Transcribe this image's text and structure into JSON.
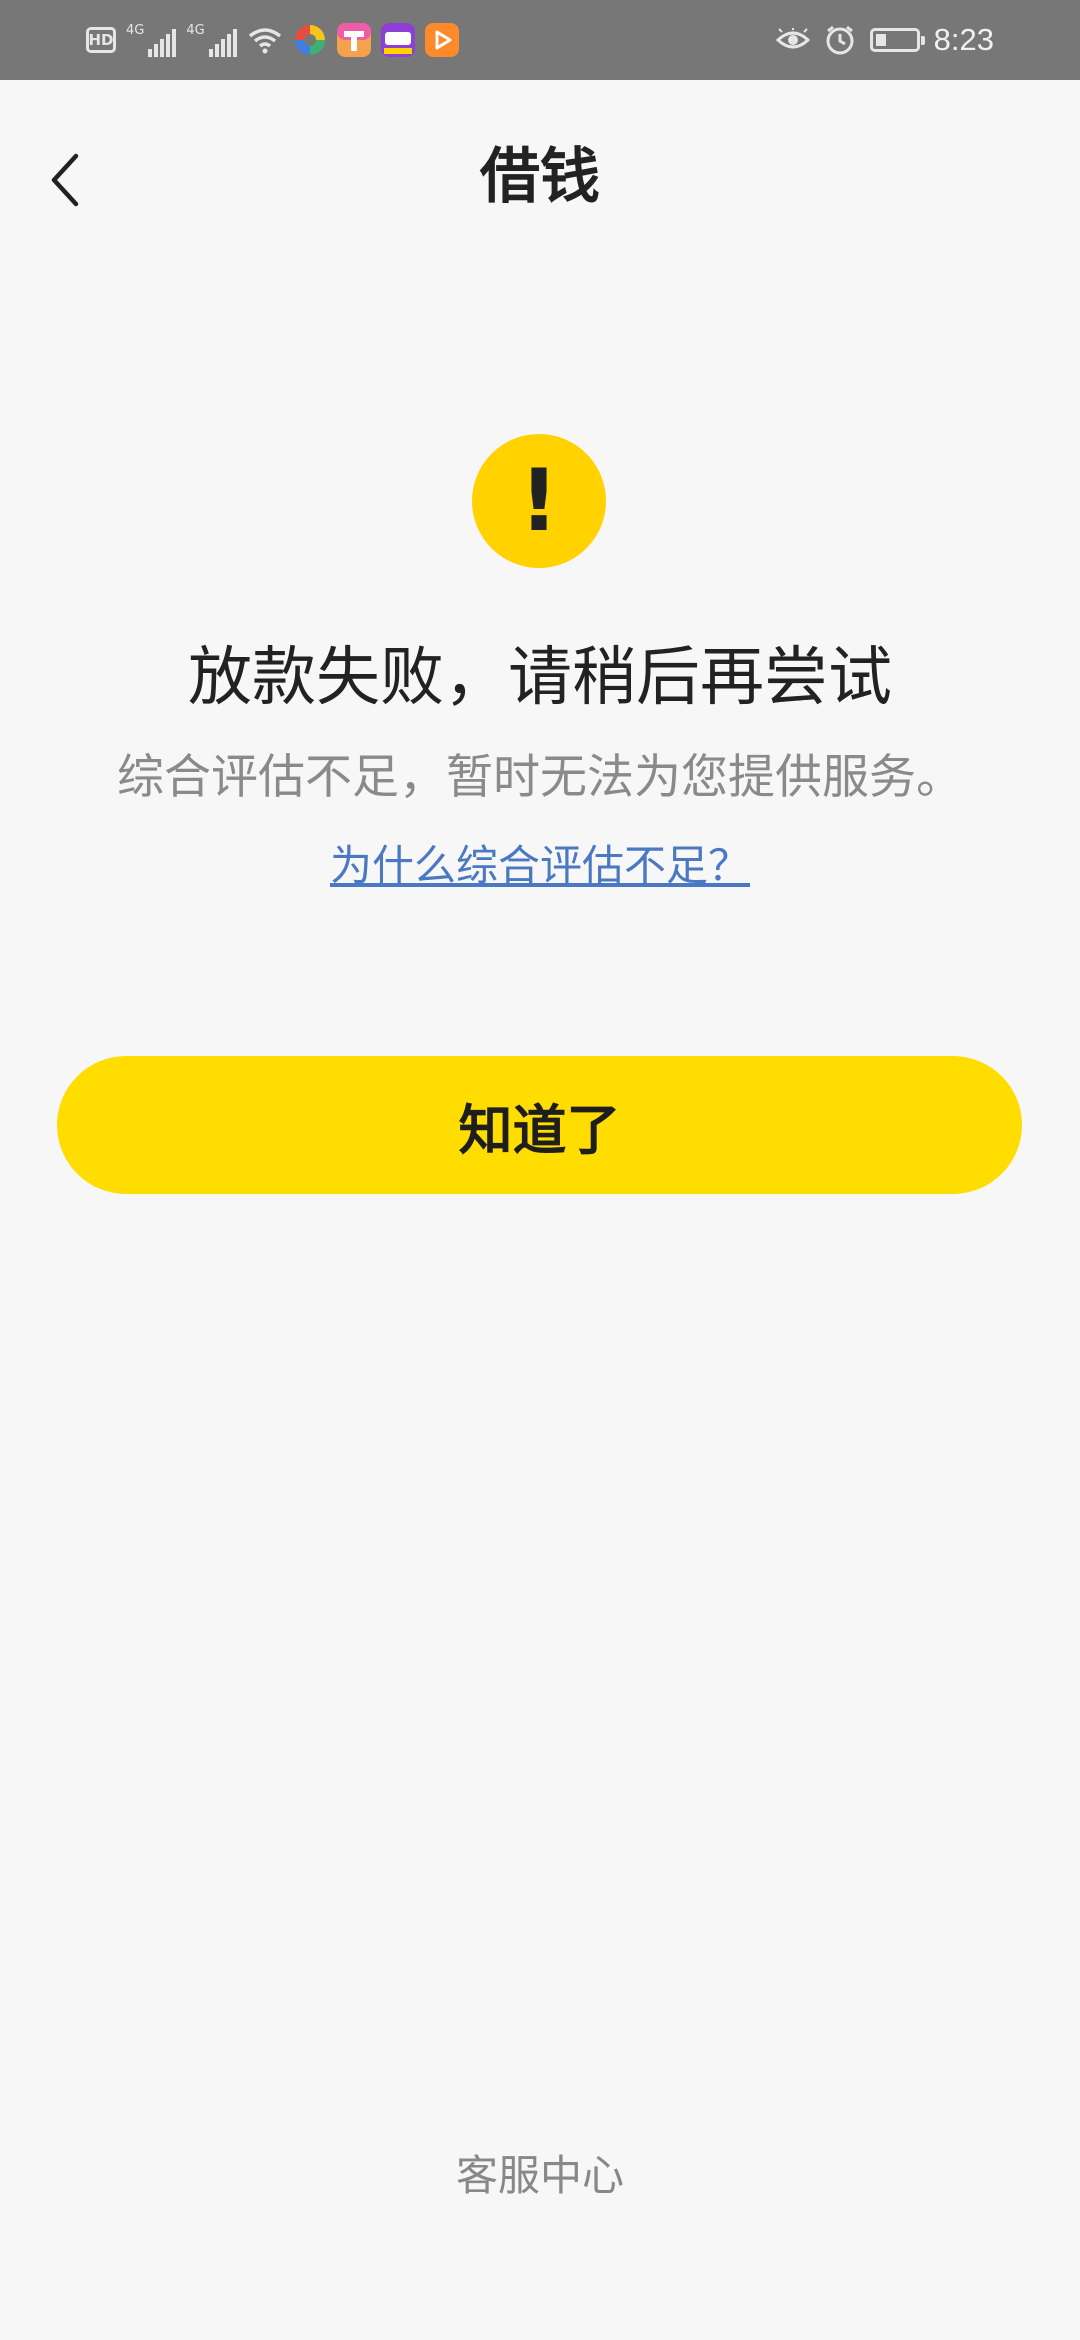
{
  "status_bar": {
    "hd_label": "HD",
    "network_1": "4G",
    "network_2": "4G",
    "time": "8:23",
    "battery_level": 0.25,
    "icons": [
      "hd-icon",
      "signal-4g-icon",
      "signal-4g-icon",
      "wifi-icon",
      "app-color-wheel-icon",
      "app-paint-icon",
      "app-game-icon",
      "app-video-play-icon",
      "eye-icon",
      "alarm-icon",
      "battery-icon"
    ]
  },
  "nav": {
    "title": "借钱",
    "back_icon": "chevron-left-icon"
  },
  "result": {
    "icon": "warning-icon",
    "mark": "!",
    "title": "放款失败，请稍后再尝试",
    "description": "综合评估不足，暂时无法为您提供服务。",
    "link": "为什么综合评估不足？"
  },
  "actions": {
    "ok_label": "知道了"
  },
  "footer": {
    "service_label": "客服中心"
  },
  "colors": {
    "accent": "#ffdd00",
    "warning": "#ffd200",
    "link": "#4a78c2",
    "background": "#f7f7f7"
  }
}
